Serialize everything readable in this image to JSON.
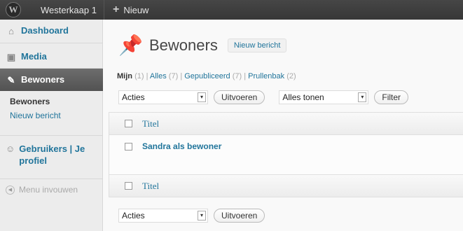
{
  "adminbar": {
    "logo": "W",
    "site_name": "Westerkaap 1",
    "new_label": "Nieuw"
  },
  "sidebar": {
    "items": [
      {
        "label": "Dashboard",
        "icon": "home-icon"
      },
      {
        "label": "Media",
        "icon": "media-icon"
      },
      {
        "label": "Bewoners",
        "icon": "pin-icon"
      },
      {
        "label": "Gebruikers | Je profiel",
        "icon": "users-icon"
      }
    ],
    "submenu": [
      "Bewoners",
      "Nieuw bericht"
    ],
    "collapse_label": "Menu invouwen"
  },
  "main": {
    "title": "Bewoners",
    "add_new": "Nieuw bericht",
    "filters": [
      {
        "label": "Mijn",
        "count": "(1)"
      },
      {
        "label": "Alles",
        "count": "(7)"
      },
      {
        "label": "Gepubliceerd",
        "count": "(7)"
      },
      {
        "label": "Prullenbak",
        "count": "(2)"
      }
    ],
    "bulk_action": "Acties",
    "apply_button": "Uitvoeren",
    "date_filter": "Alles tonen",
    "filter_button": "Filter",
    "column_title": "Titel",
    "rows": [
      {
        "title": "Sandra als bewoner"
      }
    ]
  }
}
